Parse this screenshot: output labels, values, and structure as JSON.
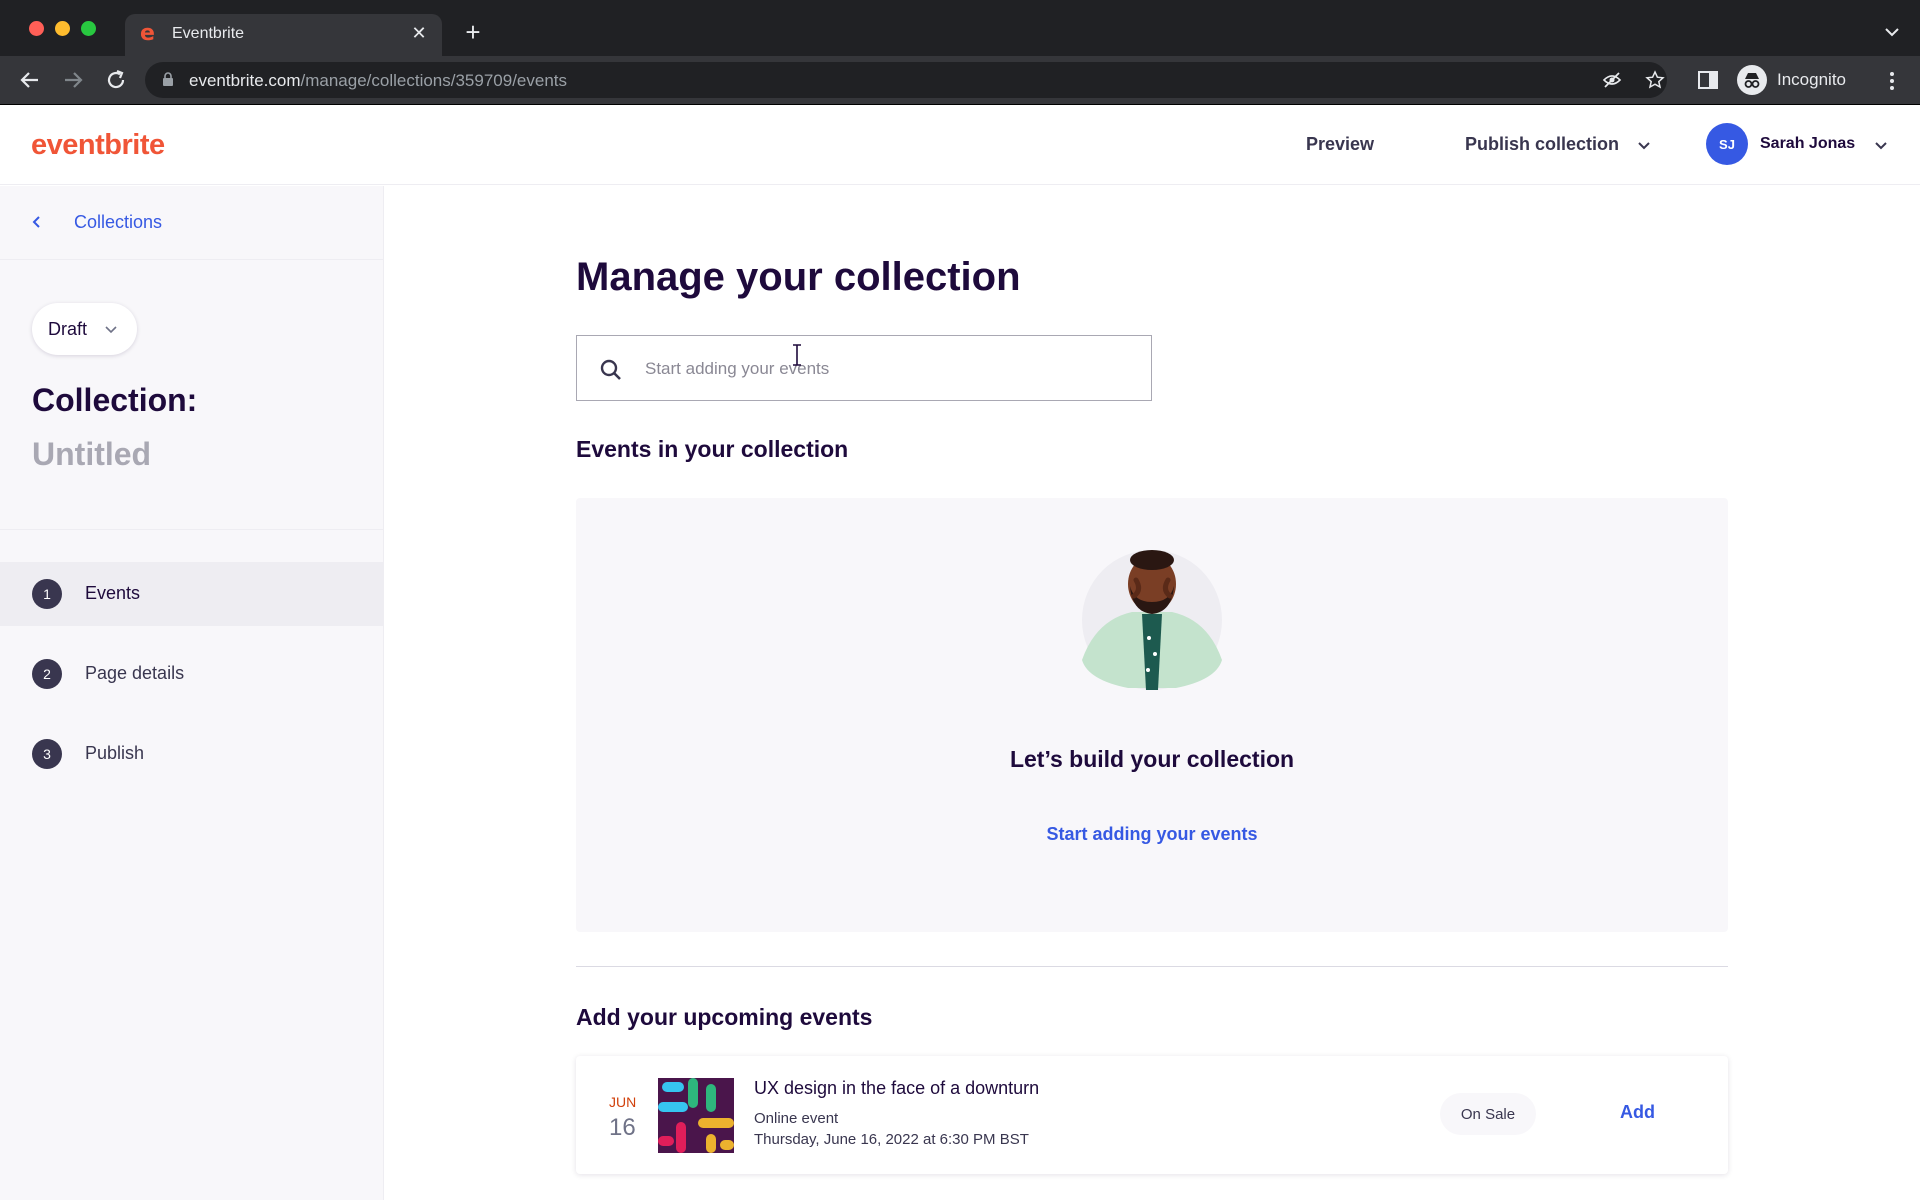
{
  "browser": {
    "tab_title": "Eventbrite",
    "url_host": "eventbrite.com",
    "url_path": "/manage/collections/359709/events",
    "incognito_label": "Incognito"
  },
  "header": {
    "logo": "eventbrite",
    "preview_label": "Preview",
    "publish_label": "Publish collection",
    "user_initials": "SJ",
    "user_name": "Sarah Jonas"
  },
  "sidebar": {
    "back_label": "Collections",
    "status": "Draft",
    "collection_label": "Collection:",
    "collection_name": "Untitled",
    "steps": [
      {
        "number": "1",
        "label": "Events"
      },
      {
        "number": "2",
        "label": "Page details"
      },
      {
        "number": "3",
        "label": "Publish"
      }
    ]
  },
  "main": {
    "title": "Manage your collection",
    "search_placeholder": "Start adding your events",
    "events_heading": "Events in your collection",
    "empty_title": "Let’s build your collection",
    "empty_link": "Start adding your events",
    "upcoming_heading": "Add your upcoming events",
    "events": [
      {
        "month": "JUN",
        "day": "16",
        "title": "UX design in the face of a downturn",
        "type": "Online event",
        "datetime": "Thursday, June 16, 2022 at 6:30 PM BST",
        "status": "On Sale",
        "action": "Add"
      }
    ]
  },
  "colors": {
    "brand": "#f05537",
    "link": "#3659e3",
    "ink": "#1e0a3c"
  }
}
